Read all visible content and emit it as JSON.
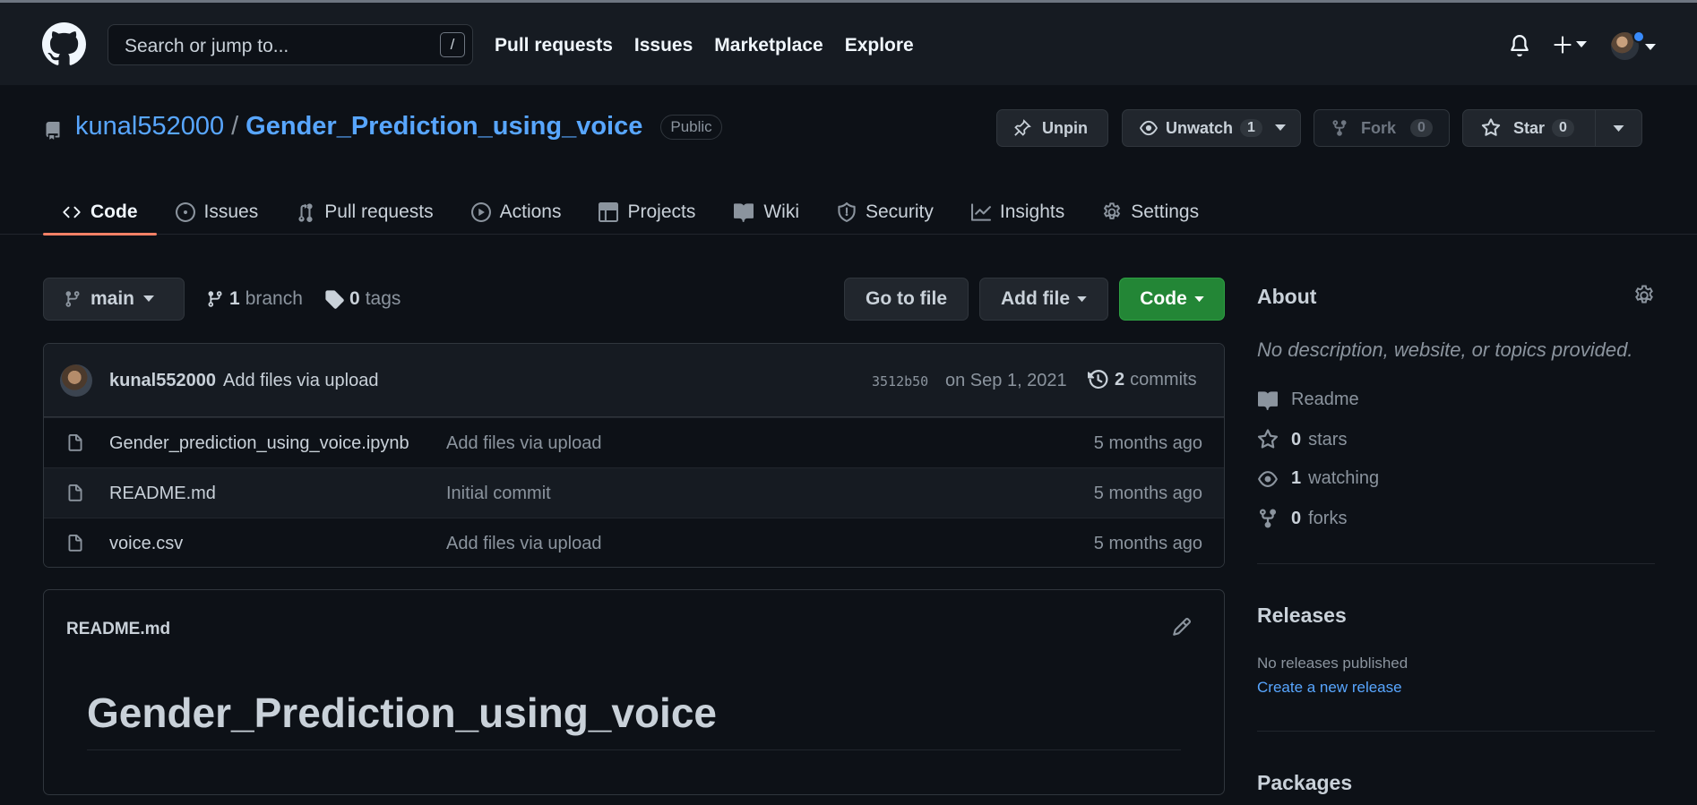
{
  "header": {
    "search_placeholder": "Search or jump to...",
    "search_shortcut": "/",
    "nav": [
      "Pull requests",
      "Issues",
      "Marketplace",
      "Explore"
    ]
  },
  "repo": {
    "owner": "kunal552000",
    "separator": "/",
    "name": "Gender_Prediction_using_voice",
    "visibility": "Public",
    "actions": {
      "unpin": "Unpin",
      "unwatch": "Unwatch",
      "watch_count": "1",
      "fork": "Fork",
      "fork_count": "0",
      "star": "Star",
      "star_count": "0"
    },
    "tabs": [
      "Code",
      "Issues",
      "Pull requests",
      "Actions",
      "Projects",
      "Wiki",
      "Security",
      "Insights",
      "Settings"
    ],
    "active_tab": "Code"
  },
  "toolbar": {
    "branch": "main",
    "branch_count": "1",
    "branch_label": "branch",
    "tag_count": "0",
    "tag_label": "tags",
    "go_to_file": "Go to file",
    "add_file": "Add file",
    "code": "Code"
  },
  "latest_commit": {
    "author": "kunal552000",
    "message": "Add files via upload",
    "sha": "3512b50",
    "date": "on Sep 1, 2021",
    "count": "2",
    "count_label": "commits"
  },
  "files": [
    {
      "name": "Gender_prediction_using_voice.ipynb",
      "message": "Add files via upload",
      "age": "5 months ago"
    },
    {
      "name": "README.md",
      "message": "Initial commit",
      "age": "5 months ago"
    },
    {
      "name": "voice.csv",
      "message": "Add files via upload",
      "age": "5 months ago"
    }
  ],
  "readme": {
    "filename": "README.md",
    "heading": "Gender_Prediction_using_voice"
  },
  "sidebar": {
    "about_title": "About",
    "description": "No description, website, or topics provided.",
    "readme": "Readme",
    "stars_count": "0",
    "stars_label": "stars",
    "watching_count": "1",
    "watching_label": "watching",
    "forks_count": "0",
    "forks_label": "forks",
    "releases_title": "Releases",
    "releases_none": "No releases published",
    "create_release": "Create a new release",
    "packages_title": "Packages"
  },
  "colors": {
    "background": "#0d1117",
    "header": "#161b22",
    "link": "#58a6ff",
    "active_tab_underline": "#f78166",
    "code_button": "#238636"
  }
}
